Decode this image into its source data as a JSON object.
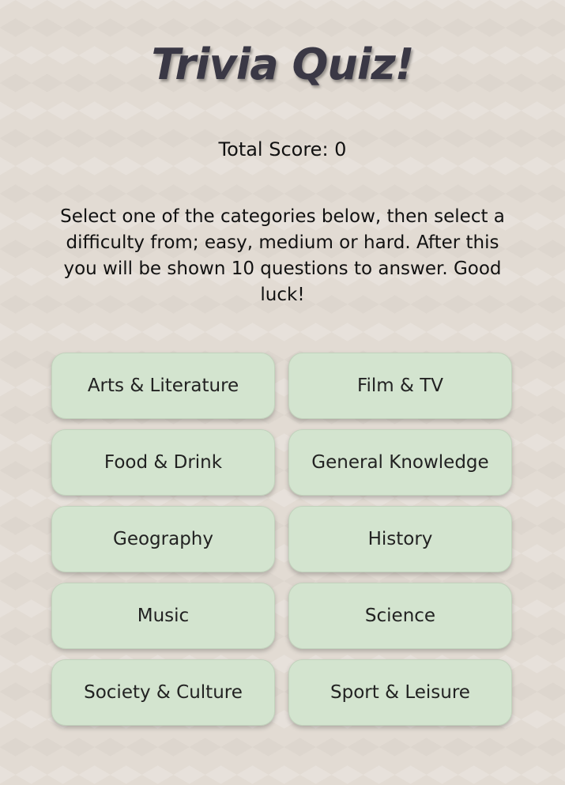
{
  "header": {
    "title": "Trivia Quiz!"
  },
  "score": {
    "text": "Total Score: 0"
  },
  "instructions": {
    "text": "Select one of the categories below, then select a difficulty from; easy, medium or hard. After this you will be shown 10 questions to answer. Good luck!"
  },
  "categories": [
    {
      "label": "Arts & Literature"
    },
    {
      "label": "Film & TV"
    },
    {
      "label": "Food & Drink"
    },
    {
      "label": "General Knowledge"
    },
    {
      "label": "Geography"
    },
    {
      "label": "History"
    },
    {
      "label": "Music"
    },
    {
      "label": "Science"
    },
    {
      "label": "Society & Culture"
    },
    {
      "label": "Sport & Leisure"
    }
  ],
  "colors": {
    "background": "#e2dbd3",
    "button_background": "#d3e4cf",
    "title": "#3a3845"
  }
}
